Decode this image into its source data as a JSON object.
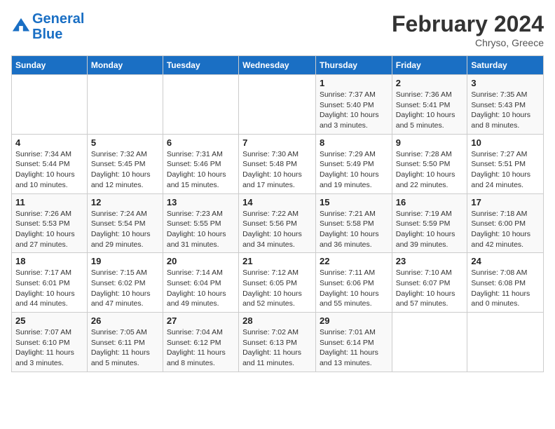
{
  "header": {
    "logo_line1": "General",
    "logo_line2": "Blue",
    "month_title": "February 2024",
    "location": "Chryso, Greece"
  },
  "days_of_week": [
    "Sunday",
    "Monday",
    "Tuesday",
    "Wednesday",
    "Thursday",
    "Friday",
    "Saturday"
  ],
  "weeks": [
    [
      {
        "num": "",
        "detail": ""
      },
      {
        "num": "",
        "detail": ""
      },
      {
        "num": "",
        "detail": ""
      },
      {
        "num": "",
        "detail": ""
      },
      {
        "num": "1",
        "detail": "Sunrise: 7:37 AM\nSunset: 5:40 PM\nDaylight: 10 hours\nand 3 minutes."
      },
      {
        "num": "2",
        "detail": "Sunrise: 7:36 AM\nSunset: 5:41 PM\nDaylight: 10 hours\nand 5 minutes."
      },
      {
        "num": "3",
        "detail": "Sunrise: 7:35 AM\nSunset: 5:43 PM\nDaylight: 10 hours\nand 8 minutes."
      }
    ],
    [
      {
        "num": "4",
        "detail": "Sunrise: 7:34 AM\nSunset: 5:44 PM\nDaylight: 10 hours\nand 10 minutes."
      },
      {
        "num": "5",
        "detail": "Sunrise: 7:32 AM\nSunset: 5:45 PM\nDaylight: 10 hours\nand 12 minutes."
      },
      {
        "num": "6",
        "detail": "Sunrise: 7:31 AM\nSunset: 5:46 PM\nDaylight: 10 hours\nand 15 minutes."
      },
      {
        "num": "7",
        "detail": "Sunrise: 7:30 AM\nSunset: 5:48 PM\nDaylight: 10 hours\nand 17 minutes."
      },
      {
        "num": "8",
        "detail": "Sunrise: 7:29 AM\nSunset: 5:49 PM\nDaylight: 10 hours\nand 19 minutes."
      },
      {
        "num": "9",
        "detail": "Sunrise: 7:28 AM\nSunset: 5:50 PM\nDaylight: 10 hours\nand 22 minutes."
      },
      {
        "num": "10",
        "detail": "Sunrise: 7:27 AM\nSunset: 5:51 PM\nDaylight: 10 hours\nand 24 minutes."
      }
    ],
    [
      {
        "num": "11",
        "detail": "Sunrise: 7:26 AM\nSunset: 5:53 PM\nDaylight: 10 hours\nand 27 minutes."
      },
      {
        "num": "12",
        "detail": "Sunrise: 7:24 AM\nSunset: 5:54 PM\nDaylight: 10 hours\nand 29 minutes."
      },
      {
        "num": "13",
        "detail": "Sunrise: 7:23 AM\nSunset: 5:55 PM\nDaylight: 10 hours\nand 31 minutes."
      },
      {
        "num": "14",
        "detail": "Sunrise: 7:22 AM\nSunset: 5:56 PM\nDaylight: 10 hours\nand 34 minutes."
      },
      {
        "num": "15",
        "detail": "Sunrise: 7:21 AM\nSunset: 5:58 PM\nDaylight: 10 hours\nand 36 minutes."
      },
      {
        "num": "16",
        "detail": "Sunrise: 7:19 AM\nSunset: 5:59 PM\nDaylight: 10 hours\nand 39 minutes."
      },
      {
        "num": "17",
        "detail": "Sunrise: 7:18 AM\nSunset: 6:00 PM\nDaylight: 10 hours\nand 42 minutes."
      }
    ],
    [
      {
        "num": "18",
        "detail": "Sunrise: 7:17 AM\nSunset: 6:01 PM\nDaylight: 10 hours\nand 44 minutes."
      },
      {
        "num": "19",
        "detail": "Sunrise: 7:15 AM\nSunset: 6:02 PM\nDaylight: 10 hours\nand 47 minutes."
      },
      {
        "num": "20",
        "detail": "Sunrise: 7:14 AM\nSunset: 6:04 PM\nDaylight: 10 hours\nand 49 minutes."
      },
      {
        "num": "21",
        "detail": "Sunrise: 7:12 AM\nSunset: 6:05 PM\nDaylight: 10 hours\nand 52 minutes."
      },
      {
        "num": "22",
        "detail": "Sunrise: 7:11 AM\nSunset: 6:06 PM\nDaylight: 10 hours\nand 55 minutes."
      },
      {
        "num": "23",
        "detail": "Sunrise: 7:10 AM\nSunset: 6:07 PM\nDaylight: 10 hours\nand 57 minutes."
      },
      {
        "num": "24",
        "detail": "Sunrise: 7:08 AM\nSunset: 6:08 PM\nDaylight: 11 hours\nand 0 minutes."
      }
    ],
    [
      {
        "num": "25",
        "detail": "Sunrise: 7:07 AM\nSunset: 6:10 PM\nDaylight: 11 hours\nand 3 minutes."
      },
      {
        "num": "26",
        "detail": "Sunrise: 7:05 AM\nSunset: 6:11 PM\nDaylight: 11 hours\nand 5 minutes."
      },
      {
        "num": "27",
        "detail": "Sunrise: 7:04 AM\nSunset: 6:12 PM\nDaylight: 11 hours\nand 8 minutes."
      },
      {
        "num": "28",
        "detail": "Sunrise: 7:02 AM\nSunset: 6:13 PM\nDaylight: 11 hours\nand 11 minutes."
      },
      {
        "num": "29",
        "detail": "Sunrise: 7:01 AM\nSunset: 6:14 PM\nDaylight: 11 hours\nand 13 minutes."
      },
      {
        "num": "",
        "detail": ""
      },
      {
        "num": "",
        "detail": ""
      }
    ]
  ]
}
